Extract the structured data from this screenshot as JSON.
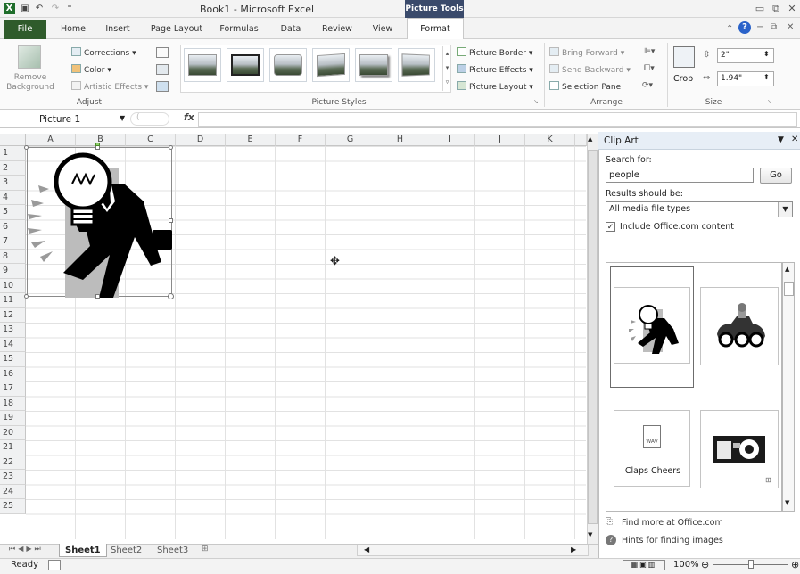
{
  "window": {
    "app_icon": "X",
    "title": "Book1 - Microsoft Excel",
    "context_tab_group": "Picture Tools",
    "min_glyph": "▭",
    "restore_glyph": "⧉",
    "close_glyph": "✕"
  },
  "quick_access": {
    "save_icon": "save-icon",
    "undo_icon": "undo-icon",
    "redo_icon": "redo-icon"
  },
  "tabs": [
    "File",
    "Home",
    "Insert",
    "Page Layout",
    "Formulas",
    "Data",
    "Review",
    "View",
    "Format"
  ],
  "ribbon": {
    "remove_background": "Remove\nBackground",
    "adjust": {
      "corrections": "Corrections ▾",
      "color": "Color ▾",
      "artistic_effects": "Artistic Effects ▾",
      "group_label": "Adjust"
    },
    "picture_styles": {
      "picture_border": "Picture Border ▾",
      "picture_effects": "Picture Effects ▾",
      "picture_layout": "Picture Layout ▾",
      "group_label": "Picture Styles"
    },
    "arrange": {
      "bring_forward": "Bring Forward ▾",
      "send_backward": "Send Backward ▾",
      "selection_pane": "Selection Pane",
      "group_label": "Arrange"
    },
    "size": {
      "crop": "Crop",
      "height": "2\"",
      "width": "1.94\"",
      "group_label": "Size"
    }
  },
  "formula_bar": {
    "name_box": "Picture 1",
    "fx": "fx",
    "value": ""
  },
  "grid": {
    "columns": [
      "A",
      "B",
      "C",
      "D",
      "E",
      "F",
      "G",
      "H",
      "I",
      "J",
      "K"
    ],
    "rows": [
      "1",
      "2",
      "3",
      "4",
      "5",
      "6",
      "7",
      "8",
      "9",
      "10",
      "11",
      "12",
      "13",
      "14",
      "15",
      "16",
      "17",
      "18",
      "19",
      "20",
      "21",
      "22",
      "23",
      "24",
      "25"
    ]
  },
  "sheets": {
    "tabs": [
      "Sheet1",
      "Sheet2",
      "Sheet3"
    ],
    "active": "Sheet1"
  },
  "status": {
    "ready": "Ready",
    "zoom": "100%"
  },
  "clip_art": {
    "title": "Clip Art",
    "search_label": "Search for:",
    "search_value": "people",
    "go": "Go",
    "results_label": "Results should be:",
    "media_type": "All media file types",
    "include_label": "Include Office.com content",
    "include_checked": "✓",
    "result_caption": "Claps Cheers",
    "wav_label": "WAV",
    "find_more": "Find more at Office.com",
    "hints": "Hints for finding images"
  }
}
